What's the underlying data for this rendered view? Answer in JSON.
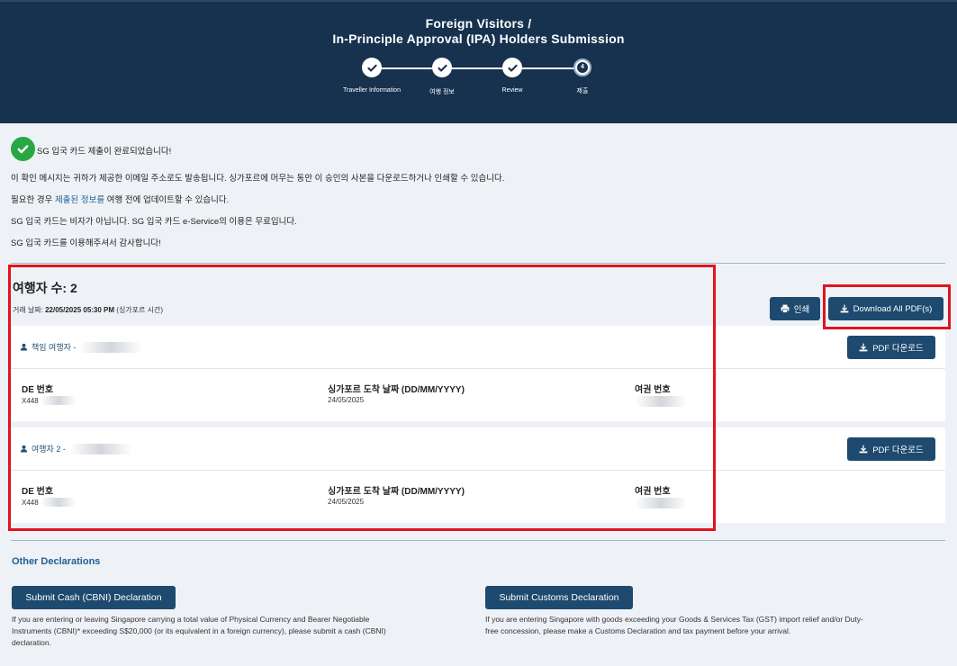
{
  "header": {
    "title_line1": "Foreign Visitors /",
    "title_line2": "In-Principle Approval (IPA) Holders Submission",
    "steps": [
      {
        "label": "Traveller Information",
        "state": "done"
      },
      {
        "label": "여행 정보",
        "state": "done"
      },
      {
        "label": "Review",
        "state": "done"
      },
      {
        "label": "제출",
        "state": "current",
        "number": "4"
      }
    ]
  },
  "confirmation": {
    "headline": "SG 입국 카드 제출이 완료되었습니다!",
    "line1": "이 확인 메시지는 귀하가 제공한 이메일 주소로도 발송됩니다. 싱가포르에 머무는 동안 이 승인의 사본을 다운로드하거나 인쇄할 수 있습니다.",
    "line2_pre": "필요한 경우 ",
    "line2_link": "제출된 정보를",
    "line2_post": " 여행 전에 업데이트할 수 있습니다.",
    "line3": "SG 입국 카드는 비자가 아닙니다. SG 입국 카드 e-Service의 이용은 무료입니다.",
    "line4": "SG 입국 카드를 이용해주셔서 감사합니다!"
  },
  "summary": {
    "traveller_count": "여행자 수: 2",
    "date_label": "거래 날짜: ",
    "date_value": "22/05/2025 05:30 PM",
    "date_suffix": " (싱가포르 시간)",
    "print_label": "인쇄",
    "download_all_label": "Download All PDF(s)"
  },
  "travellers": [
    {
      "title": "책임 여행자 -",
      "download_label": "PDF 다운로드",
      "de_label": "DE 번호",
      "de_value": "X448",
      "arrival_label": "싱가포르 도착 날짜 (DD/MM/YYYY)",
      "arrival_value": "24/05/2025",
      "passport_label": "여권 번호"
    },
    {
      "title": "여행자 2 -",
      "download_label": "PDF 다운로드",
      "de_label": "DE 번호",
      "de_value": "X448",
      "arrival_label": "싱가포르 도착 날짜 (DD/MM/YYYY)",
      "arrival_value": "24/05/2025",
      "passport_label": "여권 번호"
    }
  ],
  "other": {
    "title": "Other Declarations",
    "cbni_button": "Submit Cash (CBNI) Declaration",
    "cbni_desc_1": "If you are entering or leaving Singapore carrying a total value of Physical Currency and Bearer Negotiable",
    "cbni_desc_2": "Instruments (CBNI)* exceeding S$20,000 (or its equivalent in a foreign currency), please submit a cash (CBNI)",
    "cbni_desc_3": "declaration.",
    "customs_button": "Submit Customs Declaration",
    "customs_desc_1": "If you are entering Singapore with goods exceeding your Goods & Services Tax (GST) import relief and/or Duty-",
    "customs_desc_2": "free concession, please make a Customs Declaration and tax payment before your arrival."
  },
  "colors": {
    "header_bg": "#16324f",
    "button_bg": "#1d4a6e",
    "success": "#2aa745",
    "highlight": "#e0141e",
    "link": "#1f5f96"
  }
}
